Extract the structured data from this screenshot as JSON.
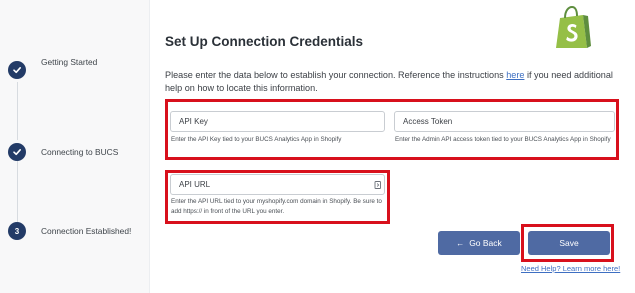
{
  "stepper": {
    "steps": [
      {
        "label": "Getting Started",
        "state": "completed",
        "icon": "checkmark-icon"
      },
      {
        "label": "Connecting to BUCS",
        "state": "completed",
        "icon": "checkmark-icon"
      },
      {
        "label": "Connection Established!",
        "state": "current",
        "number": "3"
      }
    ]
  },
  "logo": {
    "name": "shopify-logo",
    "colors": {
      "bag": "#95bf47",
      "bag_dark": "#5e8e3e",
      "letter": "#ffffff"
    }
  },
  "header": {
    "title": "Set Up Connection Credentials"
  },
  "instructions": {
    "before_link": "Please enter the data below to establish your connection. Reference the instructions ",
    "link_text": "here",
    "after_link": " if you need additional help on how to locate this information."
  },
  "fields": {
    "api_key": {
      "placeholder": "API Key",
      "value": "",
      "help": "Enter the API Key tied to your BUCS Analytics App in Shopify"
    },
    "access_token": {
      "placeholder": "Access Token",
      "value": "",
      "help": "Enter the Admin API access token tied to your BUCS Analytics App in Shopify"
    },
    "api_url": {
      "placeholder": "API URL",
      "value": "",
      "help": "Enter the API URL tied to your myshopify.com domain in Shopify. Be sure to add https:// in front of the URL you enter."
    }
  },
  "buttons": {
    "back_arrow": "←",
    "back_label": "Go Back",
    "save_label": "Save"
  },
  "footer": {
    "need_help": "Need Help? Learn more here!"
  },
  "colors": {
    "accent": "#4f6aa3",
    "step_complete": "#233b67",
    "highlight": "#d8101c",
    "link": "#3e6fc2"
  }
}
